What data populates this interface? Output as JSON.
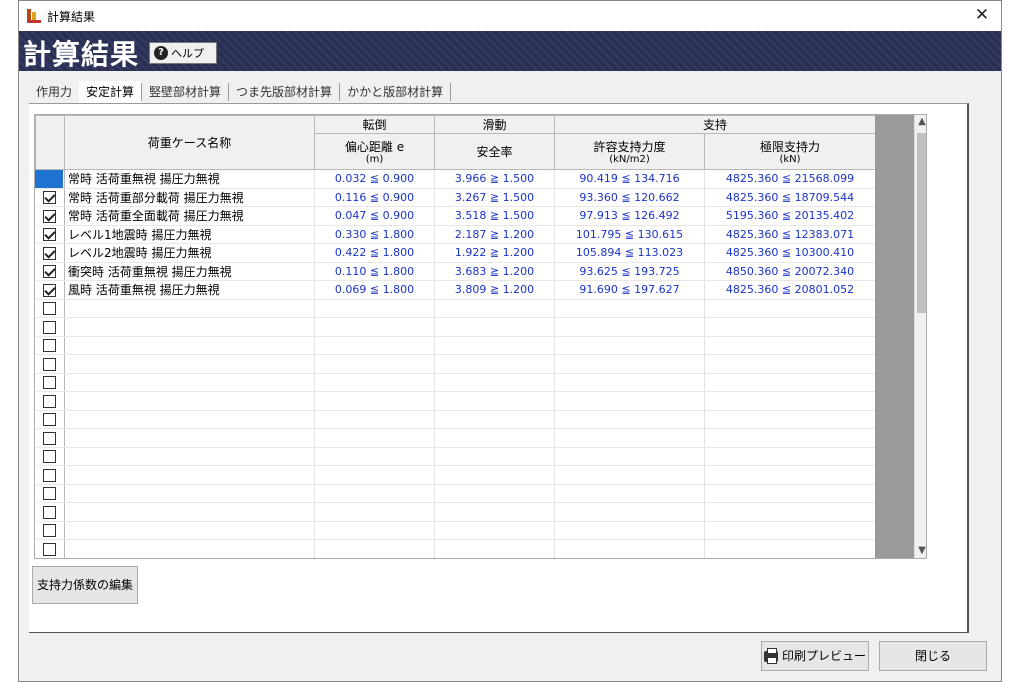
{
  "window": {
    "title": "計算結果",
    "close_symbol": "✕"
  },
  "header": {
    "title": "計算結果",
    "help_label": "ヘルプ",
    "help_symbol": "?"
  },
  "tabs": [
    {
      "label": "作用力",
      "active": false
    },
    {
      "label": "安定計算",
      "active": true
    },
    {
      "label": "竪壁部材計算",
      "active": false
    },
    {
      "label": "つま先版部材計算",
      "active": false
    },
    {
      "label": "かかと版部材計算",
      "active": false
    }
  ],
  "table": {
    "group_headers": {
      "overturn": "転倒",
      "slide": "滑動",
      "support": "支持"
    },
    "columns": {
      "name": "荷重ケース名称",
      "eccentric": "偏心距離 e",
      "eccentric_unit": "(m)",
      "safety": "安全率",
      "allow": "許容支持力度",
      "allow_unit": "(kN/m2)",
      "ultimate": "極限支持力",
      "ultimate_unit": "(kN)"
    },
    "rows": [
      {
        "checked": true,
        "name": "常時 活荷重無視 揚圧力無視",
        "e": "0.032 ≦ 0.900",
        "sf": "3.966 ≧ 1.500",
        "q": "90.419 ≦ 134.716",
        "qu": "4825.360 ≦ 21568.099"
      },
      {
        "checked": true,
        "name": "常時 活荷重部分載荷 揚圧力無視",
        "e": "0.116 ≦ 0.900",
        "sf": "3.267 ≧ 1.500",
        "q": "93.360 ≦ 120.662",
        "qu": "4825.360 ≦ 18709.544"
      },
      {
        "checked": true,
        "name": "常時 活荷重全面載荷 揚圧力無視",
        "e": "0.047 ≦ 0.900",
        "sf": "3.518 ≧ 1.500",
        "q": "97.913 ≦ 126.492",
        "qu": "5195.360 ≦ 20135.402"
      },
      {
        "checked": true,
        "name": "レベル1地震時 揚圧力無視",
        "e": "0.330 ≦ 1.800",
        "sf": "2.187 ≧ 1.200",
        "q": "101.795 ≦ 130.615",
        "qu": "4825.360 ≦ 12383.071"
      },
      {
        "checked": true,
        "name": "レベル2地震時 揚圧力無視",
        "e": "0.422 ≦ 1.800",
        "sf": "1.922 ≧ 1.200",
        "q": "105.894 ≦ 113.023",
        "qu": "4825.360 ≦ 10300.410"
      },
      {
        "checked": true,
        "name": "衝突時 活荷重無視 揚圧力無視",
        "e": "0.110 ≦ 1.800",
        "sf": "3.683 ≧ 1.200",
        "q": "93.625 ≦ 193.725",
        "qu": "4850.360 ≦ 20072.340"
      },
      {
        "checked": true,
        "name": "風時 活荷重無視 揚圧力無視",
        "e": "0.069 ≦ 1.800",
        "sf": "3.809 ≧ 1.200",
        "q": "91.690 ≦ 197.627",
        "qu": "4825.360 ≦ 20801.052"
      }
    ],
    "empty_rows": 14
  },
  "buttons": {
    "edit_coeff": "支持力係数の編集",
    "print_preview": "印刷プレビュー",
    "close": "閉じる"
  },
  "scroll": {
    "up": "▲",
    "down": "▼"
  }
}
